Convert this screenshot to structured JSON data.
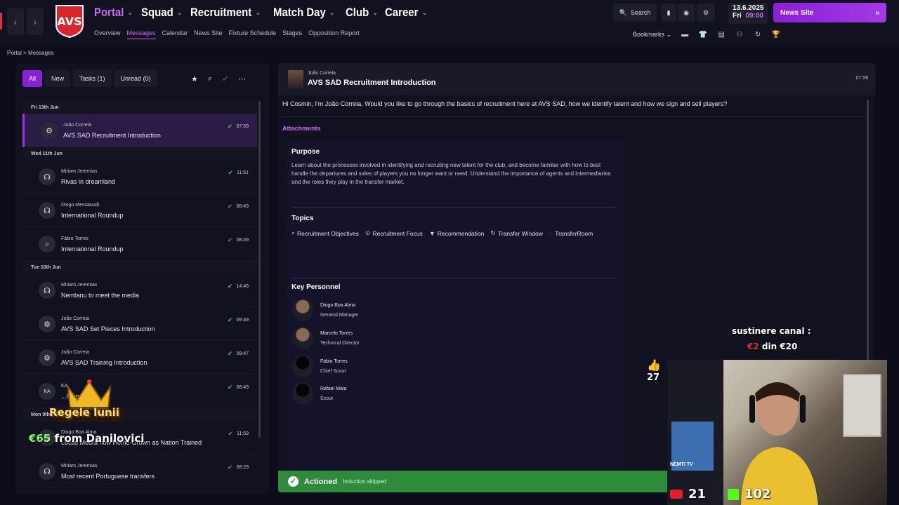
{
  "topbar": {
    "mainnav": [
      {
        "label": "Portal",
        "active": true
      },
      {
        "label": "Squad",
        "active": false
      },
      {
        "label": "Recruitment",
        "active": false
      },
      {
        "label": "Match Day",
        "active": false
      },
      {
        "label": "Club",
        "active": false
      },
      {
        "label": "Career",
        "active": false
      }
    ],
    "subnav": [
      "Overview",
      "Messages",
      "Calendar",
      "News Site",
      "Fixture Schedule",
      "Stages",
      "Opposition Report"
    ],
    "subnav_active": "Messages",
    "search_label": "Search",
    "date": "13.6.2025",
    "weekday": "Fri",
    "time": "09:00",
    "news_button": "News Site",
    "bookmarks_label": "Bookmarks",
    "accent_color": "#c86bf5"
  },
  "breadcrumb": {
    "root": "Portal",
    "separator": ">",
    "current": "Messages"
  },
  "inbox": {
    "filters": [
      {
        "label": "All",
        "active": true
      },
      {
        "label": "New",
        "active": false
      },
      {
        "label": "Tasks (1)",
        "active": false
      },
      {
        "label": "Unread (0)",
        "active": false
      }
    ],
    "groups": [
      {
        "date": "Fri 13th Jun",
        "messages": [
          {
            "sender": "João Correia",
            "subject": "AVS SAD Recruitment Introduction",
            "time": "07:59",
            "icon": "staff-group-icon",
            "read": true,
            "selected": true
          }
        ]
      },
      {
        "date": "Wed 11th Jun",
        "messages": [
          {
            "sender": "Miriam Jeremias",
            "subject": "Rivas in dreamland",
            "time": "11:51",
            "icon": "media-icon",
            "read": true,
            "selected": false
          },
          {
            "sender": "Diogo Messaoudi",
            "subject": "International Roundup",
            "time": "08:49",
            "icon": "media-icon",
            "read": false,
            "selected": false
          },
          {
            "sender": "Fábio Torres",
            "subject": "International Roundup",
            "time": "08:49",
            "icon": "scout-icon",
            "read": false,
            "selected": false
          }
        ]
      },
      {
        "date": "Tue 10th Jun",
        "messages": [
          {
            "sender": "Miriam Jeremias",
            "subject": "Nemtanu to meet the media",
            "time": "14:46",
            "icon": "media-icon",
            "read": true,
            "selected": false
          },
          {
            "sender": "João Correia",
            "subject": "AVS SAD Set Pieces Introduction",
            "time": "09:49",
            "icon": "staff-group-icon",
            "read": true,
            "selected": false
          },
          {
            "sender": "João Correia",
            "subject": "AVS SAD Training Introduction",
            "time": "09:47",
            "icon": "staff-group-icon",
            "read": true,
            "selected": false
          },
          {
            "sender": "KA",
            "subject": "...Introduction",
            "time": "08:49",
            "icon": "initials-avatar",
            "read": true,
            "selected": false
          }
        ]
      },
      {
        "date": "Mon 9th Jun",
        "messages": [
          {
            "sender": "Diogo Boa Alma",
            "subject": "Lucas Moura now Home-Grown as Nation Trained",
            "time": "11:59",
            "icon": "document-icon",
            "read": false,
            "selected": false
          },
          {
            "sender": "Miriam Jeremias",
            "subject": "Most recent Portuguese transfers",
            "time": "08:29",
            "icon": "media-icon",
            "read": false,
            "selected": false
          }
        ]
      }
    ]
  },
  "message": {
    "sender": "João Correia",
    "subject": "AVS SAD Recruitment Introduction",
    "time": "07:59",
    "body": "Hi Cosmin, I'm João Correia. Would you like to go through the basics of recruitment here at AVS SAD, how we identify talent and how we sign and sell players?",
    "attachments_label": "Attachments",
    "purpose_title": "Purpose",
    "purpose_text": "Learn about the processes involved in identifying and recruiting new talent for the club, and become familiar with how to best handle the departures and sales of players you no longer want or need. Understand the importance of agents and intermediaries and the roles they play in the transfer market.",
    "topics_title": "Topics",
    "topics": [
      "Recruitment Objectives",
      "Recruitment Focus",
      "Recommendation",
      "Transfer Window",
      "TransferRoom"
    ],
    "personnel_title": "Key Personnel",
    "personnel": [
      {
        "name": "Diogo Boa Alma",
        "role": "General Manager",
        "photo": true
      },
      {
        "name": "Marcelo Torres",
        "role": "Technical Director",
        "photo": true
      },
      {
        "name": "Fábio Torres",
        "role": "Chief Scout",
        "photo": false
      },
      {
        "name": "Rafael Maia",
        "role": "Scout",
        "photo": false
      }
    ],
    "status_label": "Actioned",
    "status_sub": "Induction skipped",
    "status_color": "#2e8b3c"
  },
  "stream_overlay": {
    "donation_title": "sustinere canal :",
    "donation_current": "€2",
    "donation_mid": "din",
    "donation_goal": "€20",
    "likes": "27",
    "crown_text": "Regele lunii",
    "donor_amount": "€65",
    "donor_text": "from Danilovici",
    "youtube_count": "21",
    "kick_count": "102",
    "cam_label": "NEMTI TV"
  }
}
